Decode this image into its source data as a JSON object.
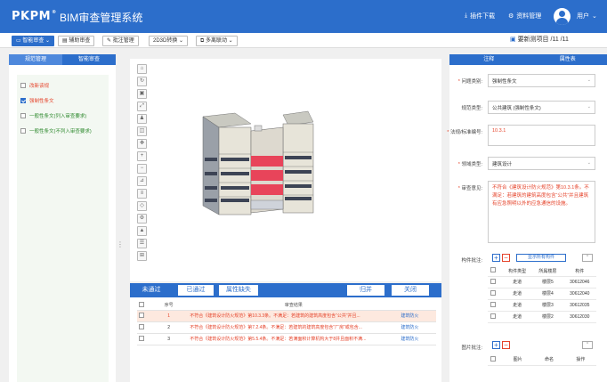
{
  "app": {
    "logo": "PKPM",
    "logo_mark": "®",
    "title": "BIM审查管理系统"
  },
  "topnav": {
    "download": "插件下载",
    "materials": "资料管理",
    "user": "用户"
  },
  "toolbar": {
    "buttons": [
      "智能审查",
      "辅助审查",
      "批注管理",
      "2D3D转换",
      "多离联动"
    ],
    "project": "要新测项目 /11 /11"
  },
  "left_panel": {
    "tabs": [
      "规范管理",
      "智能审查"
    ],
    "filters": [
      {
        "label": "改新该规",
        "checked": false
      },
      {
        "label": "强制性条文",
        "checked": true
      },
      {
        "label": "一般性条文(列入审查要求)",
        "checked": false
      },
      {
        "label": "一般性条文(不列入审查要求)",
        "checked": false
      }
    ]
  },
  "viewer": {
    "toolbar_icons": [
      "home-icon",
      "rotate-icon",
      "box-icon",
      "fit-icon",
      "walk-icon",
      "section-icon",
      "pan-icon",
      "zoom-in-icon",
      "zoom-out-icon",
      "measure-icon",
      "layers-icon",
      "tag-icon",
      "settings-icon",
      "floor-icon",
      "props-icon",
      "grid-icon"
    ]
  },
  "results": {
    "tabs": [
      "未通过",
      "已通过",
      "属性缺失"
    ],
    "buttons": {
      "collapse": "归并",
      "close": "关闭"
    },
    "headers": [
      "序号",
      "审查结果",
      ""
    ],
    "rows": [
      {
        "idx": "1",
        "text": "不符合《建筑设计防火规范》第10.3.3条。不满足：若建筑的建筑高度包含“公共”并且...",
        "action": "建筑防火",
        "selected": true
      },
      {
        "idx": "2",
        "text": "不符合《建筑设计防火规范》第7.2.4条。不满足：若建筑的建筑高度包含“厂房”或包含...",
        "action": "建筑防火",
        "selected": false
      },
      {
        "idx": "3",
        "text": "不符合《建筑设计防火规范》第5.5.4条。不满足：若满面积计算机构大于8并且面积不满...",
        "action": "建筑防火",
        "selected": false
      }
    ]
  },
  "right_panel": {
    "tabs": [
      "注释",
      "属性表"
    ],
    "fields": {
      "problem_type": {
        "label": "问题类别:",
        "value": "强制性条文"
      },
      "pro_type": {
        "label": "规范类型:",
        "value": "公共建筑 (强制性条文)"
      },
      "rule_no": {
        "label": "法规/标准编号:",
        "value": "10.3.1"
      },
      "review_type": {
        "label": "领域类型:",
        "value": "建筑设计"
      },
      "opinion": {
        "label": "审查意见:",
        "value": "不符合《建筑设计防火规范》第10.3.1条。不满足：若建筑的建筑高度包含“公共”并且建筑有应急照明以外的应急通信的设施。"
      }
    },
    "components": {
      "label": "构件批注:",
      "show_all": "显示所有构件",
      "headers": [
        "构件类型",
        "所属楼层",
        "构件"
      ],
      "rows": [
        {
          "type": "走道",
          "floor": "楼层5",
          "id": "30612046"
        },
        {
          "type": "走道",
          "floor": "楼层4",
          "id": "30612040"
        },
        {
          "type": "走道",
          "floor": "楼层3",
          "id": "30612035"
        },
        {
          "type": "走道",
          "floor": "楼层2",
          "id": "30612030"
        }
      ]
    },
    "images": {
      "label": "图片批注:",
      "headers": [
        "图片",
        "命名",
        "操作"
      ]
    }
  }
}
